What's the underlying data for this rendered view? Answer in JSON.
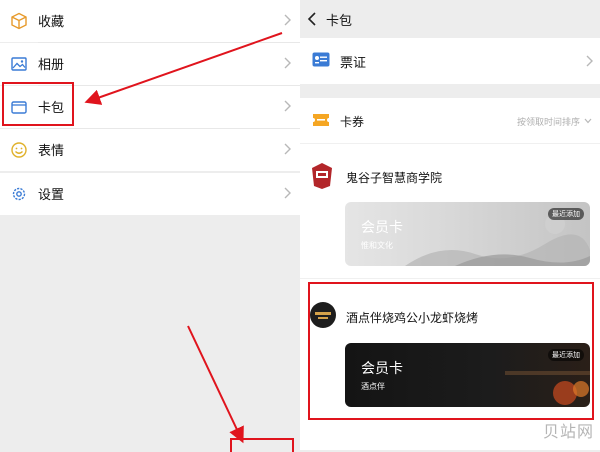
{
  "left_menu": {
    "items": [
      {
        "label": "收藏",
        "icon": "cube-icon"
      },
      {
        "label": "相册",
        "icon": "picture-icon"
      },
      {
        "label": "卡包",
        "icon": "wallet-icon"
      },
      {
        "label": "表情",
        "icon": "smiley-icon"
      },
      {
        "label": "设置",
        "icon": "gear-icon"
      }
    ]
  },
  "card_pack": {
    "title": "卡包",
    "tickets_label": "票证",
    "coupons_label": "卡券",
    "sort_label": "按领取时间排序"
  },
  "merchants": [
    {
      "name": "鬼谷子智慧商学院",
      "card_title": "会员卡",
      "card_subtitle": "惟和文化",
      "badge": "最近添加"
    },
    {
      "name": "酒点伴烧鸡公小龙虾烧烤",
      "card_title": "会员卡",
      "card_subtitle": "酒点伴",
      "badge": "最近添加"
    }
  ],
  "watermark": "贝站网",
  "colors": {
    "highlight": "#e0141d",
    "accent_blue": "#3a7bd5",
    "coupon_orange": "#f5a623"
  }
}
